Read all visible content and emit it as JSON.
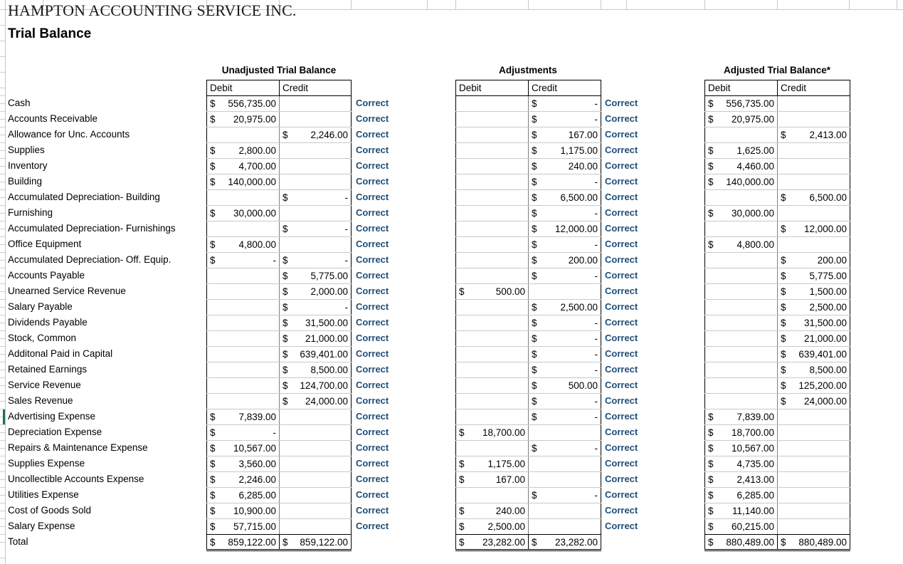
{
  "company_title": "HAMPTON ACCOUNTING SERVICE INC.",
  "doc_title": "Trial Balance",
  "sections": [
    {
      "key": "unadjusted",
      "title": "Unadjusted Trial Balance"
    },
    {
      "key": "adjustments",
      "title": "Adjustments"
    },
    {
      "key": "adjusted",
      "title": "Adjusted Trial Balance*"
    }
  ],
  "column_headers": {
    "debit": "Debit",
    "credit": "Credit"
  },
  "currency_symbol": "$",
  "dash": "-",
  "flag_label": "Correct",
  "flag_color": "#1F4E79",
  "selection_color": "#217346",
  "total_label": "Total",
  "selected_row_index": 20,
  "accounts": [
    "Cash",
    "Accounts Receivable",
    "Allowance for Unc. Accounts",
    "Supplies",
    "Inventory",
    "Building",
    "Accumulated Depreciation- Building",
    "Furnishing",
    "Accumulated Depreciation- Furnishings",
    "Office Equipment",
    "Accumulated Depreciation- Off. Equip.",
    "Accounts Payable",
    "Unearned Service Revenue",
    "Salary Payable",
    "Dividends Payable",
    "Stock, Common",
    "Additonal Paid in Capital",
    "Retained Earnings",
    "Service Revenue",
    "Sales Revenue",
    "Advertising Expense",
    "Depreciation Expense",
    "Repairs & Maintenance Expense",
    "Supplies Expense",
    "Uncollectible Accounts Expense",
    "Utilities Expense",
    "Cost of Goods Sold",
    "Salary Expense",
    "Total"
  ],
  "unadjusted": {
    "debit": [
      "556,735.00",
      "20,975.00",
      "",
      "2,800.00",
      "4,700.00",
      "140,000.00",
      "",
      "30,000.00",
      "",
      "4,800.00",
      "-",
      "",
      "",
      "",
      "",
      "",
      "",
      "",
      "",
      "",
      "7,839.00",
      "-",
      "10,567.00",
      "3,560.00",
      "2,246.00",
      "6,285.00",
      "10,900.00",
      "57,715.00"
    ],
    "credit": [
      "",
      "",
      "2,246.00",
      "",
      "",
      "",
      "-",
      "",
      "-",
      "",
      "-",
      "5,775.00",
      "2,000.00",
      "-",
      "31,500.00",
      "21,000.00",
      "639,401.00",
      "8,500.00",
      "124,700.00",
      "24,000.00",
      "",
      "",
      "",
      "",
      "",
      "",
      "",
      ""
    ],
    "total_debit": "859,122.00",
    "total_credit": "859,122.00"
  },
  "adjustments": {
    "debit": [
      "",
      "",
      "",
      "",
      "",
      "",
      "",
      "",
      "",
      "",
      "",
      "",
      "500.00",
      "",
      "",
      "",
      "",
      "",
      "",
      "",
      "",
      "18,700.00",
      "",
      "1,175.00",
      "167.00",
      "",
      "240.00",
      "2,500.00"
    ],
    "credit": [
      "-",
      "-",
      "167.00",
      "1,175.00",
      "240.00",
      "-",
      "6,500.00",
      "-",
      "12,000.00",
      "-",
      "200.00",
      "-",
      "",
      "2,500.00",
      "-",
      "-",
      "-",
      "-",
      "500.00",
      "-",
      "-",
      "",
      "-",
      "",
      "",
      "-",
      "",
      ""
    ],
    "total_debit": "23,282.00",
    "total_credit": "23,282.00"
  },
  "adjusted": {
    "debit": [
      "556,735.00",
      "20,975.00",
      "",
      "1,625.00",
      "4,460.00",
      "140,000.00",
      "",
      "30,000.00",
      "",
      "4,800.00",
      "",
      "",
      "",
      "",
      "",
      "",
      "",
      "",
      "",
      "",
      "7,839.00",
      "18,700.00",
      "10,567.00",
      "4,735.00",
      "2,413.00",
      "6,285.00",
      "11,140.00",
      "60,215.00"
    ],
    "credit": [
      "",
      "",
      "2,413.00",
      "",
      "",
      "",
      "6,500.00",
      "",
      "12,000.00",
      "",
      "200.00",
      "5,775.00",
      "1,500.00",
      "2,500.00",
      "31,500.00",
      "21,000.00",
      "639,401.00",
      "8,500.00",
      "125,200.00",
      "24,000.00",
      "",
      "",
      "",
      "",
      "",
      "",
      "",
      ""
    ],
    "total_debit": "880,489.00",
    "total_credit": "880,489.00"
  },
  "flags": {
    "unadjusted_rows": 28,
    "adjustments_rows": 28,
    "adjusted_rows": 0
  }
}
